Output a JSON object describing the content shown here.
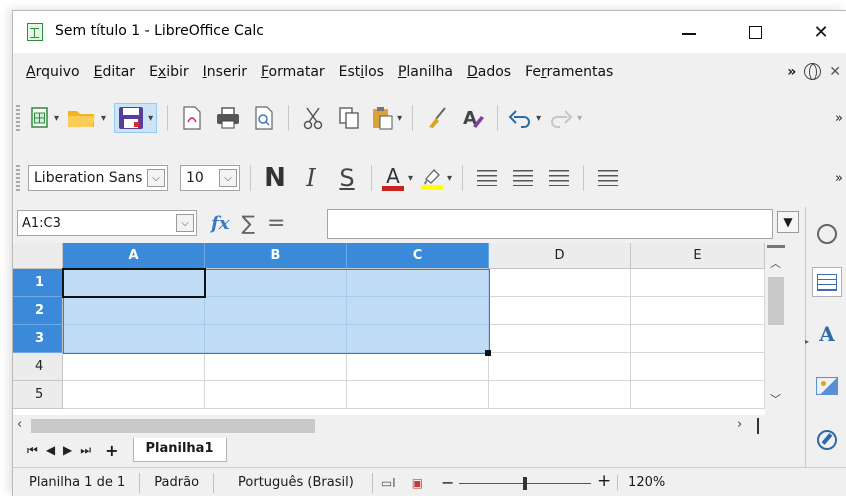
{
  "window": {
    "title": "Sem título 1 - LibreOffice Calc",
    "controls": {
      "minimize": "—",
      "maximize": "☐",
      "close": "✕"
    }
  },
  "menu": {
    "items": [
      {
        "label": "Arquivo",
        "accel": "A",
        "rest": "rquivo"
      },
      {
        "label": "Editar",
        "accel": "E",
        "rest": "ditar"
      },
      {
        "label": "Exibir",
        "pre": "E",
        "accel": "x",
        "rest": "ibir"
      },
      {
        "label": "Inserir",
        "accel": "I",
        "rest": "nserir"
      },
      {
        "label": "Formatar",
        "accel": "F",
        "rest": "ormatar"
      },
      {
        "label": "Estilos",
        "pre": "Est",
        "accel": "i",
        "rest": "los"
      },
      {
        "label": "Planilha",
        "accel": "P",
        "rest": "lanilha"
      },
      {
        "label": "Dados",
        "accel": "D",
        "rest": "ados"
      },
      {
        "label": "Ferramentas",
        "pre": "Fe",
        "accel": "r",
        "rest": "ramentas"
      }
    ],
    "overflow": "»",
    "close_doc": "✕"
  },
  "toolbar_standard": {
    "icons": [
      "new-spreadsheet-icon",
      "open-folder-icon",
      "save-icon",
      "export-pdf-icon",
      "print-icon",
      "print-preview-icon",
      "cut-icon",
      "copy-icon",
      "paste-icon",
      "clone-formatting-icon",
      "clear-formatting-icon",
      "undo-icon",
      "redo-icon"
    ],
    "overflow": "»"
  },
  "toolbar_formatting": {
    "font_name": "Liberation Sans",
    "font_size": "10",
    "bold_label": "N",
    "italic_label": "I",
    "underline_label": "S",
    "font_color_label": "A",
    "font_color": "#c9211e",
    "highlight_color": "#ffff00",
    "overflow": "»"
  },
  "formula_bar": {
    "name_box": "A1:C3",
    "fx": "fx",
    "sigma": "∑",
    "equals": "=",
    "content": ""
  },
  "grid": {
    "columns": [
      "A",
      "B",
      "C",
      "D",
      "E"
    ],
    "rows": [
      "1",
      "2",
      "3",
      "4",
      "5"
    ],
    "selected_columns": [
      "A",
      "B",
      "C"
    ],
    "selected_rows": [
      "1",
      "2",
      "3"
    ],
    "active_cell": "A1"
  },
  "sheet_tabs": {
    "nav": [
      "⏮",
      "◀",
      "▶",
      "⏭"
    ],
    "add": "+",
    "active": "Planilha1"
  },
  "status_bar": {
    "sheet_info": "Planilha 1 de 1",
    "page_style": "Padrão",
    "language": "Português (Brasil)",
    "zoom_minus": "−",
    "zoom_plus": "+",
    "zoom": "120%"
  },
  "colors": {
    "selection_fill": "#bfdcf4",
    "header_selected": "#3b8ad9",
    "accent": "#2f7fd0"
  }
}
